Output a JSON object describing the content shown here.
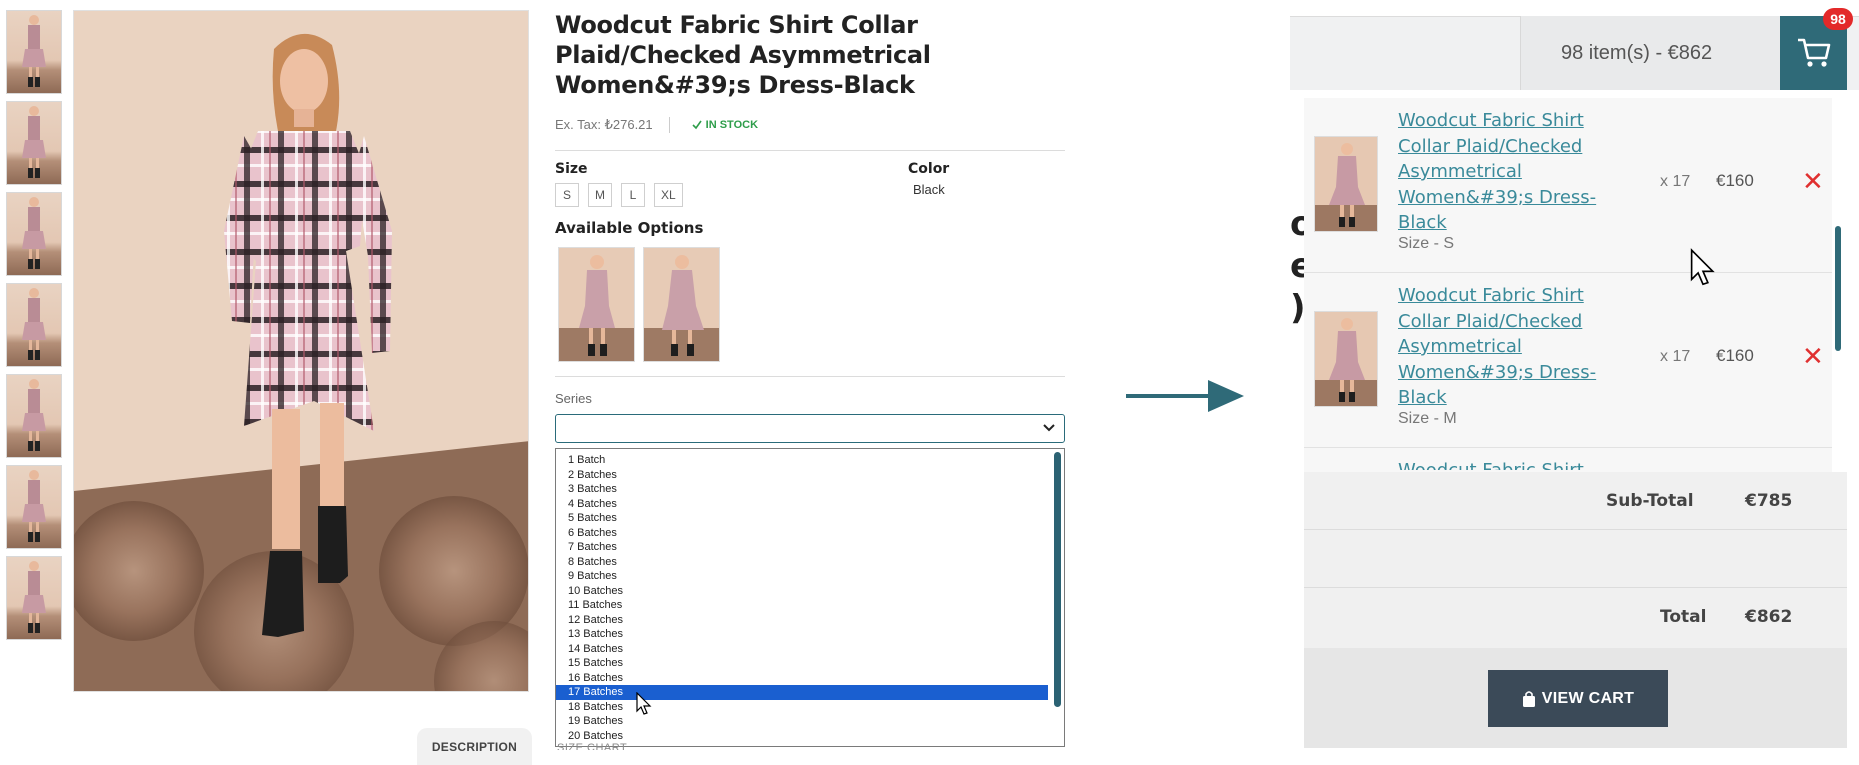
{
  "product": {
    "title": "Woodcut Fabric Shirt Collar Plaid/Checked Asymmetrical Women&#39;s Dress-Black",
    "ex_tax": "Ex. Tax: ₺276.21",
    "stock": "IN STOCK",
    "size_label": "Size",
    "sizes": [
      "S",
      "M",
      "L",
      "XL"
    ],
    "color_label": "Color",
    "color_value": "Black",
    "available_options_label": "Available Options",
    "series_label": "Series",
    "series_options": [
      "1 Batch",
      "2 Batches",
      "3 Batches",
      "4 Batches",
      "5 Batches",
      "6 Batches",
      "7 Batches",
      "8 Batches",
      "9 Batches",
      "10 Batches",
      "11 Batches",
      "12 Batches",
      "13 Batches",
      "14 Batches",
      "15 Batches",
      "16 Batches",
      "17 Batches",
      "18 Batches",
      "19 Batches",
      "20 Batches"
    ],
    "series_selected": "17 Batches",
    "description_tab": "DESCRIPTION",
    "size_chart_tab": "SIZE CHART"
  },
  "cart": {
    "summary": "98 item(s) - €862",
    "badge_count": "98",
    "items": [
      {
        "name": "Woodcut Fabric Shirt Collar Plaid/Checked Asymmetrical Women&#39;s Dress-Black",
        "option": "Size - S",
        "qty": "x 17",
        "price": "€160"
      },
      {
        "name": "Woodcut Fabric Shirt Collar Plaid/Checked Asymmetrical Women&#39;s Dress-Black",
        "option": "Size - M",
        "qty": "x 17",
        "price": "€160"
      }
    ],
    "peek_item": "Woodcut Fabric Shirt",
    "subtotal_label": "Sub-Total",
    "subtotal_value": "€785",
    "total_label": "Total",
    "total_value": "€862",
    "view_cart": "VIEW CART"
  },
  "colors": {
    "accent": "#2f6a78",
    "link": "#3a8a9a",
    "stock_green": "#2e9d4a",
    "remove_red": "#e03030",
    "selected_option": "#1a5fd0"
  }
}
